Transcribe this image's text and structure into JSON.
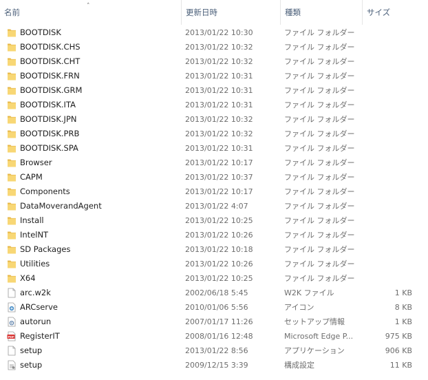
{
  "columns": {
    "name": "名前",
    "modified": "更新日時",
    "type": "種類",
    "size": "サイズ"
  },
  "colors": {
    "folder": "#f8d775",
    "folder_dark": "#e7b84a",
    "pdf_red": "#d9302f",
    "header_text": "#4c607a",
    "secondary_text": "#6d6d6d"
  },
  "items": [
    {
      "name": "BOOTDISK",
      "modified": "2013/01/22 10:30",
      "type": "ファイル フォルダー",
      "size": "",
      "icon": "folder-icon"
    },
    {
      "name": "BOOTDISK.CHS",
      "modified": "2013/01/22 10:32",
      "type": "ファイル フォルダー",
      "size": "",
      "icon": "folder-icon"
    },
    {
      "name": "BOOTDISK.CHT",
      "modified": "2013/01/22 10:32",
      "type": "ファイル フォルダー",
      "size": "",
      "icon": "folder-icon"
    },
    {
      "name": "BOOTDISK.FRN",
      "modified": "2013/01/22 10:31",
      "type": "ファイル フォルダー",
      "size": "",
      "icon": "folder-icon"
    },
    {
      "name": "BOOTDISK.GRM",
      "modified": "2013/01/22 10:31",
      "type": "ファイル フォルダー",
      "size": "",
      "icon": "folder-icon"
    },
    {
      "name": "BOOTDISK.ITA",
      "modified": "2013/01/22 10:31",
      "type": "ファイル フォルダー",
      "size": "",
      "icon": "folder-icon"
    },
    {
      "name": "BOOTDISK.JPN",
      "modified": "2013/01/22 10:32",
      "type": "ファイル フォルダー",
      "size": "",
      "icon": "folder-icon"
    },
    {
      "name": "BOOTDISK.PRB",
      "modified": "2013/01/22 10:32",
      "type": "ファイル フォルダー",
      "size": "",
      "icon": "folder-icon"
    },
    {
      "name": "BOOTDISK.SPA",
      "modified": "2013/01/22 10:31",
      "type": "ファイル フォルダー",
      "size": "",
      "icon": "folder-icon"
    },
    {
      "name": "Browser",
      "modified": "2013/01/22 10:17",
      "type": "ファイル フォルダー",
      "size": "",
      "icon": "folder-icon"
    },
    {
      "name": "CAPM",
      "modified": "2013/01/22 10:37",
      "type": "ファイル フォルダー",
      "size": "",
      "icon": "folder-icon"
    },
    {
      "name": "Components",
      "modified": "2013/01/22 10:17",
      "type": "ファイル フォルダー",
      "size": "",
      "icon": "folder-icon"
    },
    {
      "name": "DataMoverandAgent",
      "modified": "2013/01/22 4:07",
      "type": "ファイル フォルダー",
      "size": "",
      "icon": "folder-icon"
    },
    {
      "name": "Install",
      "modified": "2013/01/22 10:25",
      "type": "ファイル フォルダー",
      "size": "",
      "icon": "folder-icon"
    },
    {
      "name": "IntelNT",
      "modified": "2013/01/22 10:26",
      "type": "ファイル フォルダー",
      "size": "",
      "icon": "folder-icon"
    },
    {
      "name": "SD Packages",
      "modified": "2013/01/22 10:18",
      "type": "ファイル フォルダー",
      "size": "",
      "icon": "folder-icon"
    },
    {
      "name": "Utilities",
      "modified": "2013/01/22 10:26",
      "type": "ファイル フォルダー",
      "size": "",
      "icon": "folder-icon"
    },
    {
      "name": "X64",
      "modified": "2013/01/22 10:25",
      "type": "ファイル フォルダー",
      "size": "",
      "icon": "folder-icon"
    },
    {
      "name": "arc.w2k",
      "modified": "2002/06/18 5:45",
      "type": "W2K ファイル",
      "size": "1 KB",
      "icon": "file-icon"
    },
    {
      "name": "ARCserve",
      "modified": "2010/01/06 5:56",
      "type": "アイコン",
      "size": "8 KB",
      "icon": "app-icon"
    },
    {
      "name": "autorun",
      "modified": "2007/01/17 11:26",
      "type": "セットアップ情報",
      "size": "1 KB",
      "icon": "setup-info-icon"
    },
    {
      "name": "RegisterIT",
      "modified": "2008/01/16 12:48",
      "type": "Microsoft Edge P...",
      "size": "975 KB",
      "icon": "pdf-icon"
    },
    {
      "name": "setup",
      "modified": "2013/01/22 8:56",
      "type": "アプリケーション",
      "size": "906 KB",
      "icon": "file-icon"
    },
    {
      "name": "setup",
      "modified": "2009/12/15 3:39",
      "type": "構成設定",
      "size": "11 KB",
      "icon": "config-icon"
    }
  ]
}
